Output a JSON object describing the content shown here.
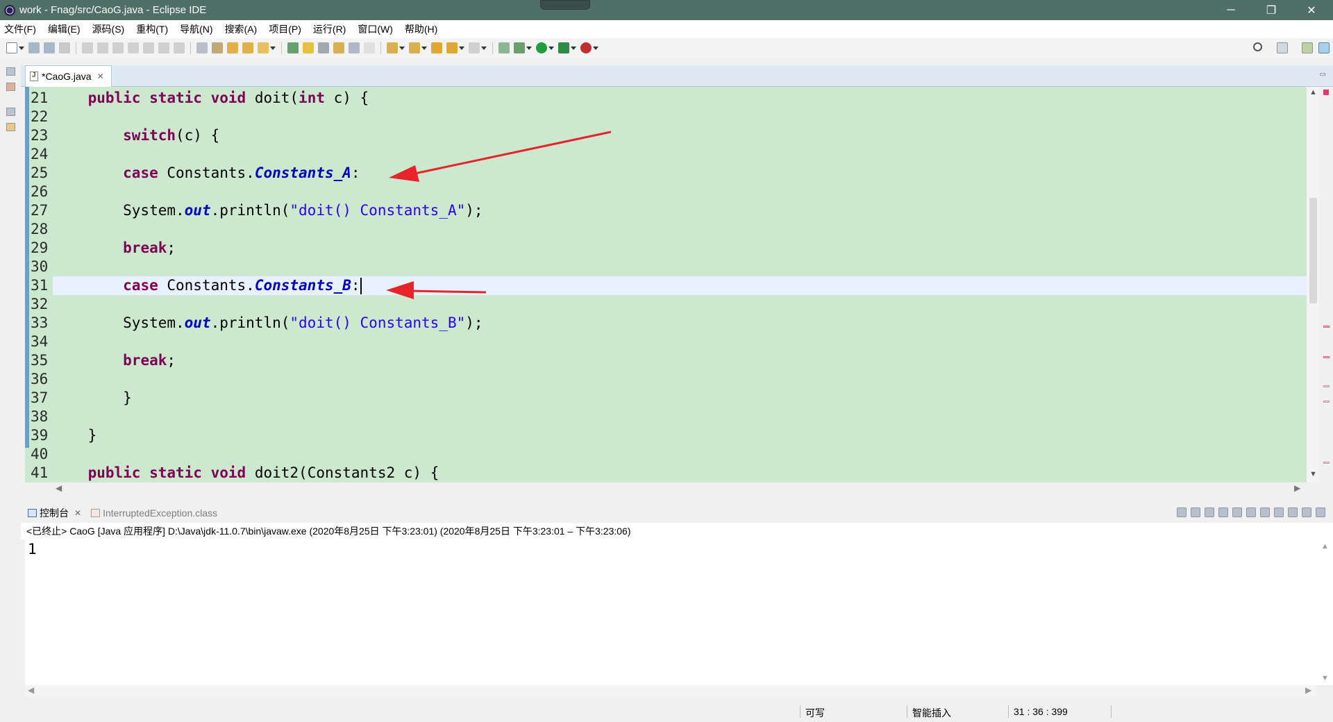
{
  "window": {
    "title": "work - Fnag/src/CaoG.java - Eclipse IDE",
    "controls": {
      "minimize": "─",
      "restore": "❐",
      "close": "✕"
    }
  },
  "menubar": {
    "items": [
      "文件(F)",
      "编辑(E)",
      "源码(S)",
      "重构(T)",
      "导航(N)",
      "搜索(A)",
      "项目(P)",
      "运行(R)",
      "窗口(W)",
      "帮助(H)"
    ]
  },
  "editor": {
    "tab_label": "*CaoG.java",
    "lines": [
      {
        "num": "21",
        "tokens": [
          {
            "t": "    "
          },
          {
            "t": "public",
            "c": "kw"
          },
          {
            "t": " "
          },
          {
            "t": "static",
            "c": "kw"
          },
          {
            "t": " "
          },
          {
            "t": "void",
            "c": "kw"
          },
          {
            "t": " doit("
          },
          {
            "t": "int",
            "c": "kw"
          },
          {
            "t": " c) {"
          }
        ]
      },
      {
        "num": "22",
        "tokens": []
      },
      {
        "num": "23",
        "tokens": [
          {
            "t": "        "
          },
          {
            "t": "switch",
            "c": "kw"
          },
          {
            "t": "(c) {"
          }
        ]
      },
      {
        "num": "24",
        "tokens": []
      },
      {
        "num": "25",
        "tokens": [
          {
            "t": "        "
          },
          {
            "t": "case",
            "c": "kw"
          },
          {
            "t": " Constants."
          },
          {
            "t": "Constants_A",
            "c": "fld"
          },
          {
            "t": ":"
          }
        ]
      },
      {
        "num": "26",
        "tokens": []
      },
      {
        "num": "27",
        "tokens": [
          {
            "t": "        System."
          },
          {
            "t": "out",
            "c": "fld"
          },
          {
            "t": ".println("
          },
          {
            "t": "\"doit() Constants_A\"",
            "c": "str"
          },
          {
            "t": ");"
          }
        ]
      },
      {
        "num": "28",
        "tokens": []
      },
      {
        "num": "29",
        "tokens": [
          {
            "t": "        "
          },
          {
            "t": "break",
            "c": "kw"
          },
          {
            "t": ";"
          }
        ]
      },
      {
        "num": "30",
        "tokens": []
      },
      {
        "num": "31",
        "current": true,
        "tokens": [
          {
            "t": "        "
          },
          {
            "t": "case",
            "c": "kw"
          },
          {
            "t": " Constants."
          },
          {
            "t": "Constants_B",
            "c": "fld"
          },
          {
            "t": ":"
          }
        ]
      },
      {
        "num": "32",
        "tokens": []
      },
      {
        "num": "33",
        "tokens": [
          {
            "t": "        System."
          },
          {
            "t": "out",
            "c": "fld"
          },
          {
            "t": ".println("
          },
          {
            "t": "\"doit() Constants_B\"",
            "c": "str"
          },
          {
            "t": ");"
          }
        ]
      },
      {
        "num": "34",
        "tokens": []
      },
      {
        "num": "35",
        "tokens": [
          {
            "t": "        "
          },
          {
            "t": "break",
            "c": "kw"
          },
          {
            "t": ";"
          }
        ]
      },
      {
        "num": "36",
        "tokens": []
      },
      {
        "num": "37",
        "tokens": [
          {
            "t": "        }"
          }
        ]
      },
      {
        "num": "38",
        "tokens": []
      },
      {
        "num": "39",
        "tokens": [
          {
            "t": "    }"
          }
        ]
      },
      {
        "num": "40",
        "tokens": []
      },
      {
        "num": "41",
        "tokens": [
          {
            "t": "    "
          },
          {
            "t": "public",
            "c": "kw"
          },
          {
            "t": " "
          },
          {
            "t": "static",
            "c": "kw"
          },
          {
            "t": " "
          },
          {
            "t": "void",
            "c": "kw"
          },
          {
            "t": " doit2(Constants2 c) {"
          }
        ]
      }
    ]
  },
  "console": {
    "tab_label": "控制台",
    "other_tab_label": "InterruptedException.class",
    "status": "<已终止> CaoG [Java 应用程序] D:\\Java\\jdk-11.0.7\\bin\\javaw.exe  (2020年8月25日 下午3:23:01)   (2020年8月25日 下午3:23:01 – 下午3:23:06)",
    "output": "1"
  },
  "statusbar": {
    "writable": "可写",
    "insert_mode": "智能插入",
    "position": "31 : 36 : 399"
  },
  "colors": {
    "editor_bg": "#cce8cf",
    "current_line": "#e8f2fe",
    "keyword": "#7f0055",
    "field": "#0000c0",
    "string": "#2a00ff",
    "annotation_arrow": "#e8232a"
  }
}
